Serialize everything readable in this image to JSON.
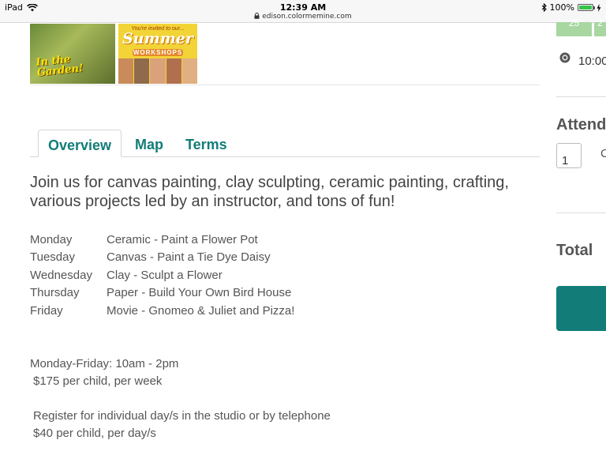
{
  "status_bar": {
    "device": "iPad",
    "time": "12:39 AM",
    "url": "edison.colormemine.com",
    "battery": "100%"
  },
  "thumbnails": {
    "garden_text": "In the Garden!",
    "summer_top": "You're invited to our...",
    "summer_title": "Summer",
    "summer_sub": "WORKSHOPS"
  },
  "tabs": [
    {
      "label": "Overview"
    },
    {
      "label": "Map"
    },
    {
      "label": "Terms"
    }
  ],
  "overview": {
    "intro": "Join us for canvas painting, clay sculpting, ceramic painting, crafting, various projects led by an instructor, and tons of fun!",
    "schedule": [
      {
        "day": "Monday",
        "activity": "Ceramic - Paint a Flower Pot"
      },
      {
        "day": "Tuesday",
        "activity": "Canvas - Paint a Tie Dye Daisy"
      },
      {
        "day": "Wednesday",
        "activity": "Clay - Sculpt a Flower"
      },
      {
        "day": "Thursday",
        "activity": "Paper - Build Your Own Bird House"
      },
      {
        "day": "Friday",
        "activity": "Movie - Gnomeo & Juliet and Pizza!"
      }
    ],
    "hours": "Monday-Friday: 10am - 2pm",
    "weekly_price": "$175 per child, per week",
    "register_note": "Register for individual day/s in the studio or by telephone",
    "daily_price": "$40 per child, per day/s"
  },
  "sidebar": {
    "calendar_day_1": "25",
    "calendar_day_2": "2",
    "time": "10:00",
    "attendees_label": "Attend",
    "quantity": "1",
    "quantity_extra": "C",
    "total_label": "Total"
  },
  "colors": {
    "accent": "#127d78",
    "calendar": "#a8d7a2"
  }
}
